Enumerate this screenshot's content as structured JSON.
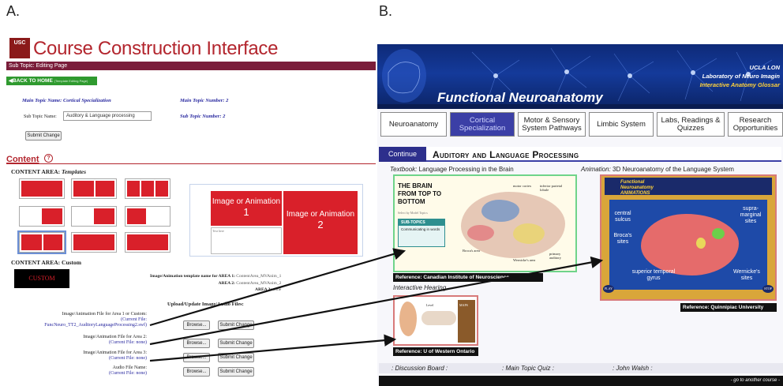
{
  "panels": {
    "a": "A.",
    "b": "B."
  },
  "left": {
    "logo_text": "USC",
    "title": "Course Construction Interface",
    "subtopic_bar": "Sub Topic: Editing Page",
    "back_button": "BACK TO HOME",
    "back_button_note": "(Template Editing Page)",
    "main_topic_name_label": "Main Topic Name: Cortical Specialization",
    "main_topic_number_label": "Main Topic Number: 2",
    "sub_topic_name_label": "Sub Topic Name:",
    "sub_topic_name_value": "Auditory & Language processing",
    "sub_topic_number_label": "Sub Topic Number: 2",
    "submit_change": "Submit Change",
    "content_heading": "Content",
    "help_icon": "?",
    "templates_heading_prefix": "CONTENT AREA: ",
    "templates_heading_em": "Templates",
    "custom_heading": "CONTENT AREA: Custom",
    "custom_button": "CUSTOM",
    "template_thumbs": [
      "Image or Animation",
      "Image or Animation 1 2",
      "Image or Animation 1 2 3",
      "Image or Animation",
      "Image or Animation 1",
      "Image or Animation 1",
      "Image or Animation 1 2",
      "Image or Animation",
      "Image or Animation"
    ],
    "preview": {
      "area1": "Image or Animation",
      "area1_num": "1",
      "area2": "Image or Animation",
      "area2_num": "2",
      "text_placeholder": "Text here"
    },
    "template_names": {
      "heading": "Image/Animation template name for AREA 1:",
      "area1_value": "ContentArea_MVAnim_1",
      "area2_label": "AREA 2:",
      "area2_value": "ContentArea_MVAnim_2",
      "area3_label": "AREA 3:",
      "area3_value": "none"
    },
    "upload_heading": "Upload/Update Image/Audio Files:",
    "uploads": [
      {
        "label": "Image/Animation File for Area 1 or Custom:",
        "current": "(Current File:",
        "file": "FuncNeuro_TT2_AuditoryLanguageProcessing2.swf)"
      },
      {
        "label": "Image/Animation File for Area 2:",
        "current": "(Current File: none)",
        "file": ""
      },
      {
        "label": "Image/Animation File for Area 3:",
        "current": "(Current File: none)",
        "file": ""
      },
      {
        "label": "Audio File Name:",
        "current": "(Current File: none)",
        "file": ""
      }
    ],
    "browse": "Browse...",
    "submit": "Submit Change"
  },
  "right": {
    "banner_title": "Functional Neuroanatomy",
    "banner_line1": "UCLA LON",
    "banner_line2": "Laboratory of Neuro Imagin",
    "banner_line3": "Interactive Anatomy Glossar",
    "nav": [
      "Neuroanatomy",
      "Cortical Specialization",
      "Motor & Sensory System Pathways",
      "Limbic System",
      "Labs, Readings & Quizzes",
      "Research Opportunities"
    ],
    "continue": "Continue",
    "topic_title": "Auditory and Language Processing",
    "textbook_label": "Textbook:",
    "textbook_caption": "Language Processing in the Brain",
    "animation_label": "Animation:",
    "animation_caption": "3D Neuroanatomy of the Language System",
    "brain_title": "THE BRAIN FROM TOP TO BOTTOM",
    "brain_sub": "Select by Model Topics",
    "subtopics_head": "SUB-TOPICS",
    "subtopics_item": "Communicating in words",
    "tb_labels": [
      "motor cortex",
      "inferior parietal lobule",
      "Broca's area",
      "Wernicke's area",
      "primary auditory"
    ],
    "ref_textbook": "Reference: Canadian Institute of Neuroscience",
    "anim_header1": "Functional",
    "anim_header2": "Neuroanatomy",
    "anim_header3": "ANIMATIONS",
    "anim_labels": [
      "central sulcus",
      "Broca's sites",
      "supra-marginal sites",
      "superior temporal gyrus",
      "Wernicke's sites"
    ],
    "anim_play": "PLAY",
    "anim_stop": "STOP",
    "ref_animation": "Reference: Quinnipiac University",
    "hearing_caption": "Interactive Hearing",
    "hearing_labels": [
      "Level",
      "MAPS"
    ],
    "ref_hearing": "Reference: U of Western Ontario",
    "bottom_links": [
      ": Discussion Board :",
      ": Main Topic Quiz :",
      ": John Walsh :"
    ],
    "footer": "- go to another course -"
  },
  "colors": {
    "usc_red": "#b3262e",
    "template_red": "#d9202a",
    "nav_active": "#3b3fa6",
    "banner_blue": "#143a9a"
  }
}
